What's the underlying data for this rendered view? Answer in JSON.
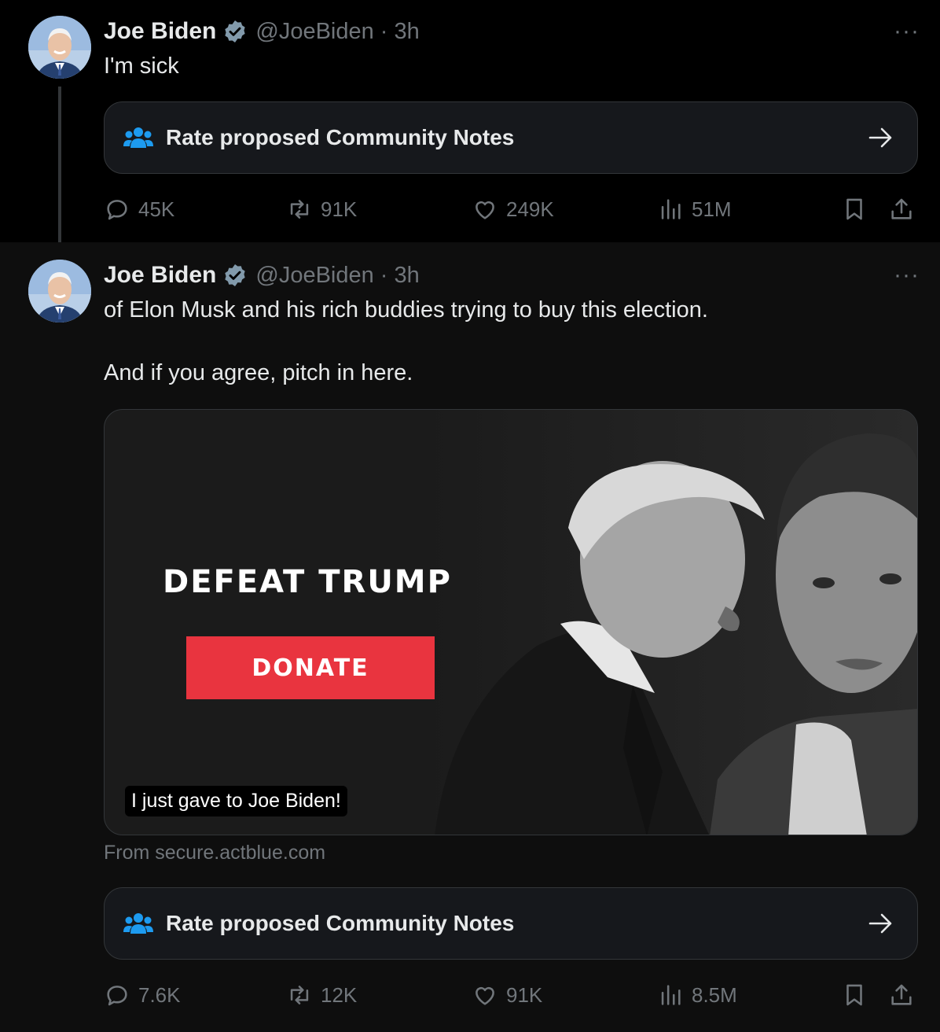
{
  "colors": {
    "background": "#000000",
    "text_primary": "#e7e9ea",
    "text_secondary": "#71767b",
    "verified": "#829aab",
    "community_notes_icon": "#1d9bf0",
    "donate_button": "#e9343f"
  },
  "tweets": [
    {
      "author_name": "Joe Biden",
      "handle": "@JoeBiden",
      "time": "· 3h",
      "more_label": "···",
      "text": "I'm sick",
      "community_notes": {
        "icon": "people-icon",
        "label": "Rate proposed Community Notes",
        "arrow": "arrow-right-icon"
      },
      "stats": {
        "replies": "45K",
        "reposts": "91K",
        "likes": "249K",
        "views": "51M"
      }
    },
    {
      "author_name": "Joe Biden",
      "handle": "@JoeBiden",
      "time": "· 3h",
      "more_label": "···",
      "text_line1": "of Elon Musk and his rich buddies trying to buy this election.",
      "text_line2": "And if you agree, pitch in here.",
      "card": {
        "headline": "DEFEAT TRUMP",
        "button": "DONATE",
        "caption": "I just gave to Joe Biden!",
        "source": "From secure.actblue.com"
      },
      "community_notes": {
        "icon": "people-icon",
        "label": "Rate proposed Community Notes",
        "arrow": "arrow-right-icon"
      },
      "stats": {
        "replies": "7.6K",
        "reposts": "12K",
        "likes": "91K",
        "views": "8.5M"
      }
    }
  ]
}
